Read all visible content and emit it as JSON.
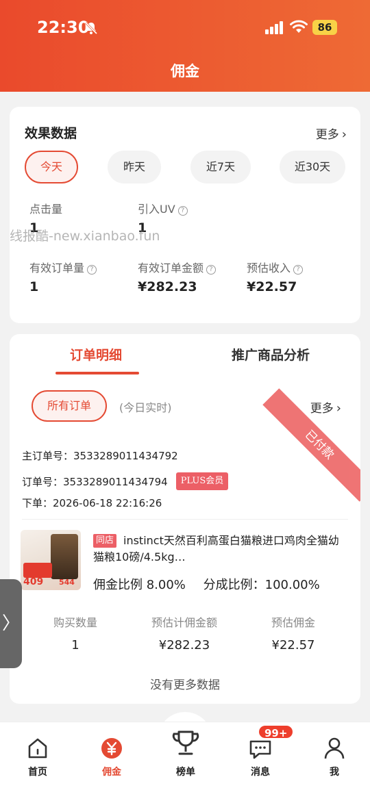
{
  "status_bar": {
    "time": "22:30",
    "battery": "86"
  },
  "header": {
    "title": "佣金"
  },
  "effect": {
    "title": "效果数据",
    "more": "更多",
    "ranges": [
      "今天",
      "昨天",
      "近7天",
      "近30天"
    ],
    "selected_range": "今天",
    "metrics": {
      "clicks": {
        "label": "点击量",
        "value": "1"
      },
      "uv": {
        "label": "引入UV",
        "value": "1"
      },
      "orders": {
        "label": "有效订单量",
        "value": "1"
      },
      "amount": {
        "label": "有效订单金额",
        "value": "¥282.23"
      },
      "income": {
        "label": "预估收入",
        "value": "¥22.57"
      }
    }
  },
  "watermark": "线报酷-new.xianbao.fun",
  "orders": {
    "tabs": [
      "订单明细",
      "推广商品分析"
    ],
    "active_tab": "订单明细",
    "filter": "所有订单",
    "filter_note": "(今日实时)",
    "more": "更多",
    "paid_label": "已付款",
    "main_order": "主订单号：3533289011434792",
    "order_no": "订单号：3533289011434794",
    "member_badge": "PLUS会员",
    "order_time": "下单：2026-06-18 22:16:26",
    "product": {
      "store_tag": "同店",
      "title": "instinct天然百利高蛋白猫粮进口鸡肉全猫幼猫粮10磅/4.5kg…",
      "commission_ratio": "佣金比例 8.00%",
      "share_ratio": "分成比例：100.00%",
      "image_price": "409",
      "image_price2": "544"
    },
    "stats": [
      {
        "label": "购买数量",
        "value": "1"
      },
      {
        "label": "预估计佣金额",
        "value": "¥282.23"
      },
      {
        "label": "预估佣金",
        "value": "¥22.57"
      }
    ],
    "no_more": "没有更多数据"
  },
  "tabbar": {
    "items": [
      {
        "label": "首页",
        "icon": "home-icon"
      },
      {
        "label": "佣金",
        "icon": "yen-icon"
      },
      {
        "label": "榜单",
        "icon": "trophy-icon"
      },
      {
        "label": "消息",
        "icon": "message-icon"
      },
      {
        "label": "我",
        "icon": "user-icon"
      }
    ],
    "active": "佣金",
    "message_badge": "99+"
  },
  "colors": {
    "brand": "#e44a33",
    "header_start": "#ea4a2c",
    "header_end": "#ee6a35",
    "badge": "#ec5f66"
  }
}
